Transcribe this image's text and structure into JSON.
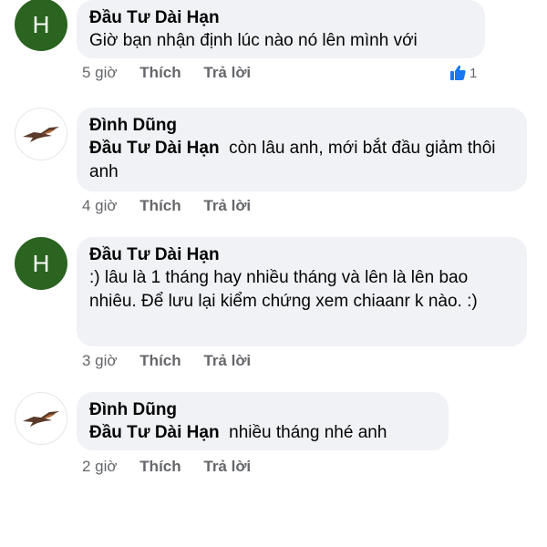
{
  "comments": [
    {
      "avatar_letter": "H",
      "author": "Đầu Tư Dài Hạn",
      "mention": "",
      "text": "Giờ bạn nhận định lúc nào nó lên mình với",
      "time": "5 giờ",
      "like_label": "Thích",
      "reply_label": "Trả lời",
      "reaction_count": "1"
    },
    {
      "avatar_icon": "bird-icon",
      "author": "Đình Dũng",
      "mention": "Đầu Tư Dài Hạn",
      "text": "còn lâu anh, mới bắt đầu giảm thôi anh",
      "time": "4 giờ",
      "like_label": "Thích",
      "reply_label": "Trả lời"
    },
    {
      "avatar_letter": "H",
      "author": "Đầu Tư Dài Hạn",
      "mention": "",
      "text": ":) lâu là 1 tháng hay nhiều tháng và lên là lên bao nhiêu. Để lưu lại kiểm chứng xem chiaanr k nào. :)",
      "time": "3 giờ",
      "like_label": "Thích",
      "reply_label": "Trả lời"
    },
    {
      "avatar_icon": "bird-icon",
      "author": "Đình Dũng",
      "mention": "Đầu Tư Dài Hạn",
      "text": "nhiều tháng nhé anh",
      "time": "2 giờ",
      "like_label": "Thích",
      "reply_label": "Trả lời"
    }
  ],
  "colors": {
    "bubble": "#f0f2f5",
    "avatar_green": "#2b6321",
    "meta_gray": "#65676b",
    "like_blue": "#1877f2"
  }
}
